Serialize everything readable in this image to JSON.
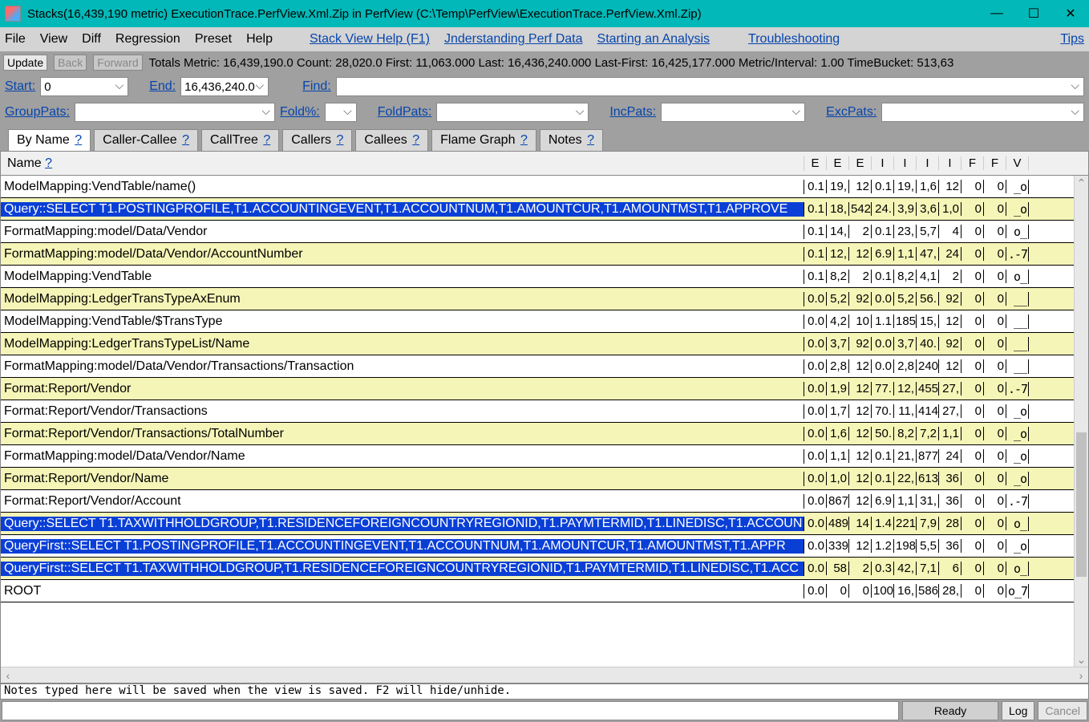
{
  "titlebar": {
    "title": "Stacks(16,439,190 metric) ExecutionTrace.PerfView.Xml.Zip in PerfView (C:\\Temp\\PerfView\\ExecutionTrace.PerfView.Xml.Zip)"
  },
  "menu": {
    "file": "File",
    "view": "View",
    "diff": "Diff",
    "regression": "Regression",
    "preset": "Preset",
    "help": "Help",
    "stack_view_help": "Stack View Help (F1)",
    "understanding": "Jnderstanding Perf Data",
    "starting": "Starting an Analysis",
    "troubleshooting": "Troubleshooting",
    "tips": "Tips"
  },
  "toolbar1": {
    "update": "Update",
    "back": "Back",
    "forward": "Forward",
    "stats": "Totals Metric: 16,439,190.0   Count: 28,020.0   First: 11,063.000 Last: 16,436,240.000   Last-First: 16,425,177.000   Metric/Interval: 1.00   TimeBucket: 513,63"
  },
  "toolbar2": {
    "start_label": "Start:",
    "start_value": "0",
    "end_label": "End:",
    "end_value": "16,436,240.0",
    "find_label": "Find:",
    "find_value": ""
  },
  "toolbar3": {
    "grouppats_label": "GroupPats:",
    "grouppats_value": "",
    "foldpct_label": "Fold%:",
    "foldpct_value": "",
    "foldpats_label": "FoldPats:",
    "foldpats_value": "",
    "incpats_label": "IncPats:",
    "incpats_value": "",
    "excpats_label": "ExcPats:",
    "excpats_value": ""
  },
  "tabs": {
    "by_name": "By Name",
    "caller_callee": "Caller-Callee",
    "calltree": "CallTree",
    "callers": "Callers",
    "callees": "Callees",
    "flame_graph": "Flame Graph",
    "notes": "Notes",
    "q": "?"
  },
  "grid": {
    "header_name": "Name",
    "header_q": "?",
    "cols": [
      "E",
      "E",
      "E",
      "I",
      "I",
      "I",
      "I",
      "F",
      "F",
      "V"
    ],
    "rows": [
      {
        "name": "ModelMapping:VendTable/name()",
        "sel": false,
        "alt": false,
        "v": [
          "0.1",
          "19,",
          "12",
          "0.1",
          "19,",
          "1,6",
          "12",
          "0",
          "0",
          "_o"
        ]
      },
      {
        "name": "Query::SELECT T1.POSTINGPROFILE,T1.ACCOUNTINGEVENT,T1.ACCOUNTNUM,T1.AMOUNTCUR,T1.AMOUNTMST,T1.APPROVE",
        "sel": true,
        "alt": true,
        "v": [
          "0.1",
          "18,",
          "542",
          "24.",
          "3,9",
          "3,6",
          "1,0",
          "0",
          "0",
          "_o"
        ]
      },
      {
        "name": "FormatMapping:model/Data/Vendor",
        "sel": false,
        "alt": false,
        "v": [
          "0.1",
          "14,",
          "2",
          "0.1",
          "23,",
          "5,7",
          "4",
          "0",
          "0",
          "o_"
        ]
      },
      {
        "name": "FormatMapping:model/Data/Vendor/AccountNumber",
        "sel": false,
        "alt": true,
        "v": [
          "0.1",
          "12,",
          "12",
          "6.9",
          "1,1",
          "47,",
          "24",
          "0",
          "0",
          ".-7"
        ]
      },
      {
        "name": "ModelMapping:VendTable",
        "sel": false,
        "alt": false,
        "v": [
          "0.1",
          "8,2",
          "2",
          "0.1",
          "8,2",
          "4,1",
          "2",
          "0",
          "0",
          "o_"
        ]
      },
      {
        "name": "ModelMapping:LedgerTransTypeAxEnum",
        "sel": false,
        "alt": true,
        "v": [
          "0.0",
          "5,2",
          "92",
          "0.0",
          "5,2",
          "56.",
          "92",
          "0",
          "0",
          "__"
        ]
      },
      {
        "name": "ModelMapping:VendTable/$TransType",
        "sel": false,
        "alt": false,
        "v": [
          "0.0",
          "4,2",
          "10",
          "1.1",
          "185",
          "15,",
          "12",
          "0",
          "0",
          "__"
        ]
      },
      {
        "name": "ModelMapping:LedgerTransTypeList/Name",
        "sel": false,
        "alt": true,
        "v": [
          "0.0",
          "3,7",
          "92",
          "0.0",
          "3,7",
          "40.",
          "92",
          "0",
          "0",
          "__"
        ]
      },
      {
        "name": "FormatMapping:model/Data/Vendor/Transactions/Transaction",
        "sel": false,
        "alt": false,
        "v": [
          "0.0",
          "2,8",
          "12",
          "0.0",
          "2,8",
          "240",
          "12",
          "0",
          "0",
          "__"
        ]
      },
      {
        "name": "Format:Report/Vendor",
        "sel": false,
        "alt": true,
        "v": [
          "0.0",
          "1,9",
          "12",
          "77.",
          "12,",
          "455",
          "27,",
          "0",
          "0",
          ".-7"
        ]
      },
      {
        "name": "Format:Report/Vendor/Transactions",
        "sel": false,
        "alt": false,
        "v": [
          "0.0",
          "1,7",
          "12",
          "70.",
          "11,",
          "414",
          "27,",
          "0",
          "0",
          "_o"
        ]
      },
      {
        "name": "Format:Report/Vendor/Transactions/TotalNumber",
        "sel": false,
        "alt": true,
        "v": [
          "0.0",
          "1,6",
          "12",
          "50.",
          "8,2",
          "7,2",
          "1,1",
          "0",
          "0",
          "_o"
        ]
      },
      {
        "name": "FormatMapping:model/Data/Vendor/Name",
        "sel": false,
        "alt": false,
        "v": [
          "0.0",
          "1,1",
          "12",
          "0.1",
          "21,",
          "877",
          "24",
          "0",
          "0",
          "_o"
        ]
      },
      {
        "name": "Format:Report/Vendor/Name",
        "sel": false,
        "alt": true,
        "v": [
          "0.0",
          "1,0",
          "12",
          "0.1",
          "22,",
          "613",
          "36",
          "0",
          "0",
          "_o"
        ]
      },
      {
        "name": "Format:Report/Vendor/Account",
        "sel": false,
        "alt": false,
        "v": [
          "0.0",
          "867",
          "12",
          "6.9",
          "1,1",
          "31,",
          "36",
          "0",
          "0",
          ".-7"
        ]
      },
      {
        "name": "Query::SELECT T1.TAXWITHHOLDGROUP,T1.RESIDENCEFOREIGNCOUNTRYREGIONID,T1.PAYMTERMID,T1.LINEDISC,T1.ACCOUN",
        "sel": true,
        "alt": true,
        "v": [
          "0.0",
          "489",
          "14",
          "1.4",
          "221",
          "7,9",
          "28",
          "0",
          "0",
          "o_"
        ]
      },
      {
        "name": "QueryFirst::SELECT T1.POSTINGPROFILE,T1.ACCOUNTINGEVENT,T1.ACCOUNTNUM,T1.AMOUNTCUR,T1.AMOUNTMST,T1.APPR",
        "sel": true,
        "alt": false,
        "v": [
          "0.0",
          "339",
          "12",
          "1.2",
          "198",
          "5,5",
          "36",
          "0",
          "0",
          "_o"
        ]
      },
      {
        "name": "QueryFirst::SELECT T1.TAXWITHHOLDGROUP,T1.RESIDENCEFOREIGNCOUNTRYREGIONID,T1.PAYMTERMID,T1.LINEDISC,T1.ACC",
        "sel": true,
        "alt": true,
        "v": [
          "0.0",
          "58",
          "2",
          "0.3",
          "42,",
          "7,1",
          "6",
          "0",
          "0",
          "o_"
        ]
      },
      {
        "name": "ROOT",
        "sel": false,
        "alt": false,
        "v": [
          "0.0",
          "0",
          "0",
          "100",
          "16,",
          "586",
          "28,",
          "0",
          "0",
          "o_7"
        ]
      }
    ]
  },
  "notes": {
    "placeholder": "Notes typed here will be saved when the view is saved. F2 will hide/unhide."
  },
  "status": {
    "ready": "Ready",
    "log": "Log",
    "cancel": "Cancel"
  }
}
